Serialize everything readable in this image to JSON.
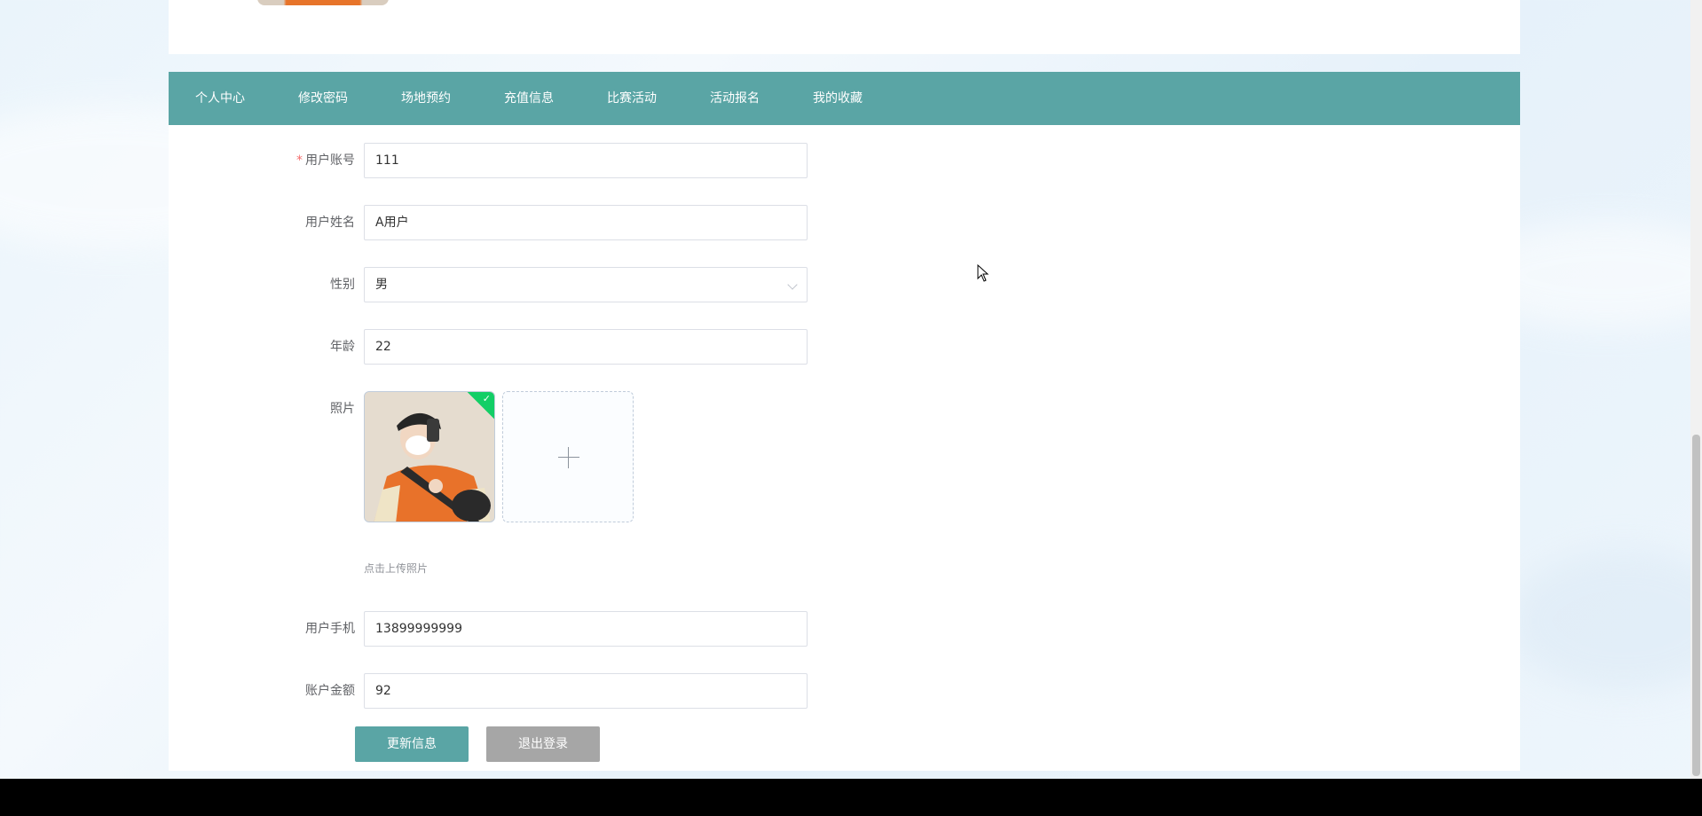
{
  "nav": {
    "items": [
      {
        "label": "个人中心"
      },
      {
        "label": "修改密码"
      },
      {
        "label": "场地预约"
      },
      {
        "label": "充值信息"
      },
      {
        "label": "比赛活动"
      },
      {
        "label": "活动报名"
      },
      {
        "label": "我的收藏"
      }
    ]
  },
  "form": {
    "account": {
      "label": "用户账号",
      "required_mark": "*",
      "value": "111"
    },
    "name": {
      "label": "用户姓名",
      "value": "A用户"
    },
    "gender": {
      "label": "性别",
      "value": "男"
    },
    "age": {
      "label": "年龄",
      "value": "22"
    },
    "photo": {
      "label": "照片",
      "upload_tip": "点击上传照片"
    },
    "phone": {
      "label": "用户手机",
      "value": "13899999999"
    },
    "balance": {
      "label": "账户金额",
      "value": "92"
    }
  },
  "buttons": {
    "update_label": "更新信息",
    "logout_label": "退出登录"
  },
  "colors": {
    "nav_bg": "#5aa5a5",
    "update_button": "#5aa5a5",
    "logout_button": "#a6a6a6",
    "required": "#f56c6c",
    "upload_success": "#13ce66"
  },
  "icons": [
    "chevron-down-icon",
    "check-icon",
    "plus-icon",
    "mouse-cursor-icon"
  ]
}
